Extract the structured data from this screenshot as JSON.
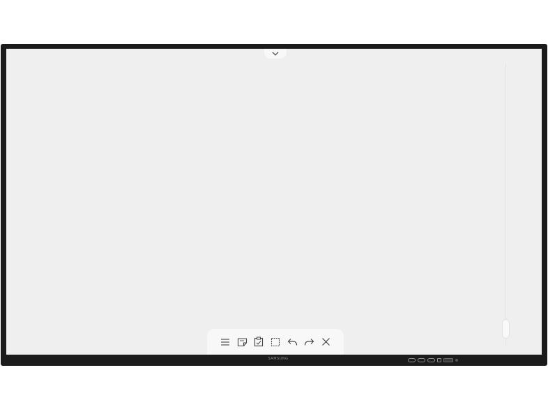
{
  "device": {
    "brand_label": "SAMSUNG"
  },
  "whiteboard": {
    "background": "#efefef",
    "bezel_color": "#1b1b1b",
    "top_handle_icon": "chevron-down-icon",
    "toolbar": {
      "tools": [
        {
          "icon": "menu-icon"
        },
        {
          "icon": "sticky-note-icon"
        },
        {
          "icon": "paste-icon"
        },
        {
          "icon": "select-icon"
        },
        {
          "icon": "undo-icon"
        },
        {
          "icon": "redo-icon"
        },
        {
          "icon": "close-icon"
        }
      ]
    }
  }
}
